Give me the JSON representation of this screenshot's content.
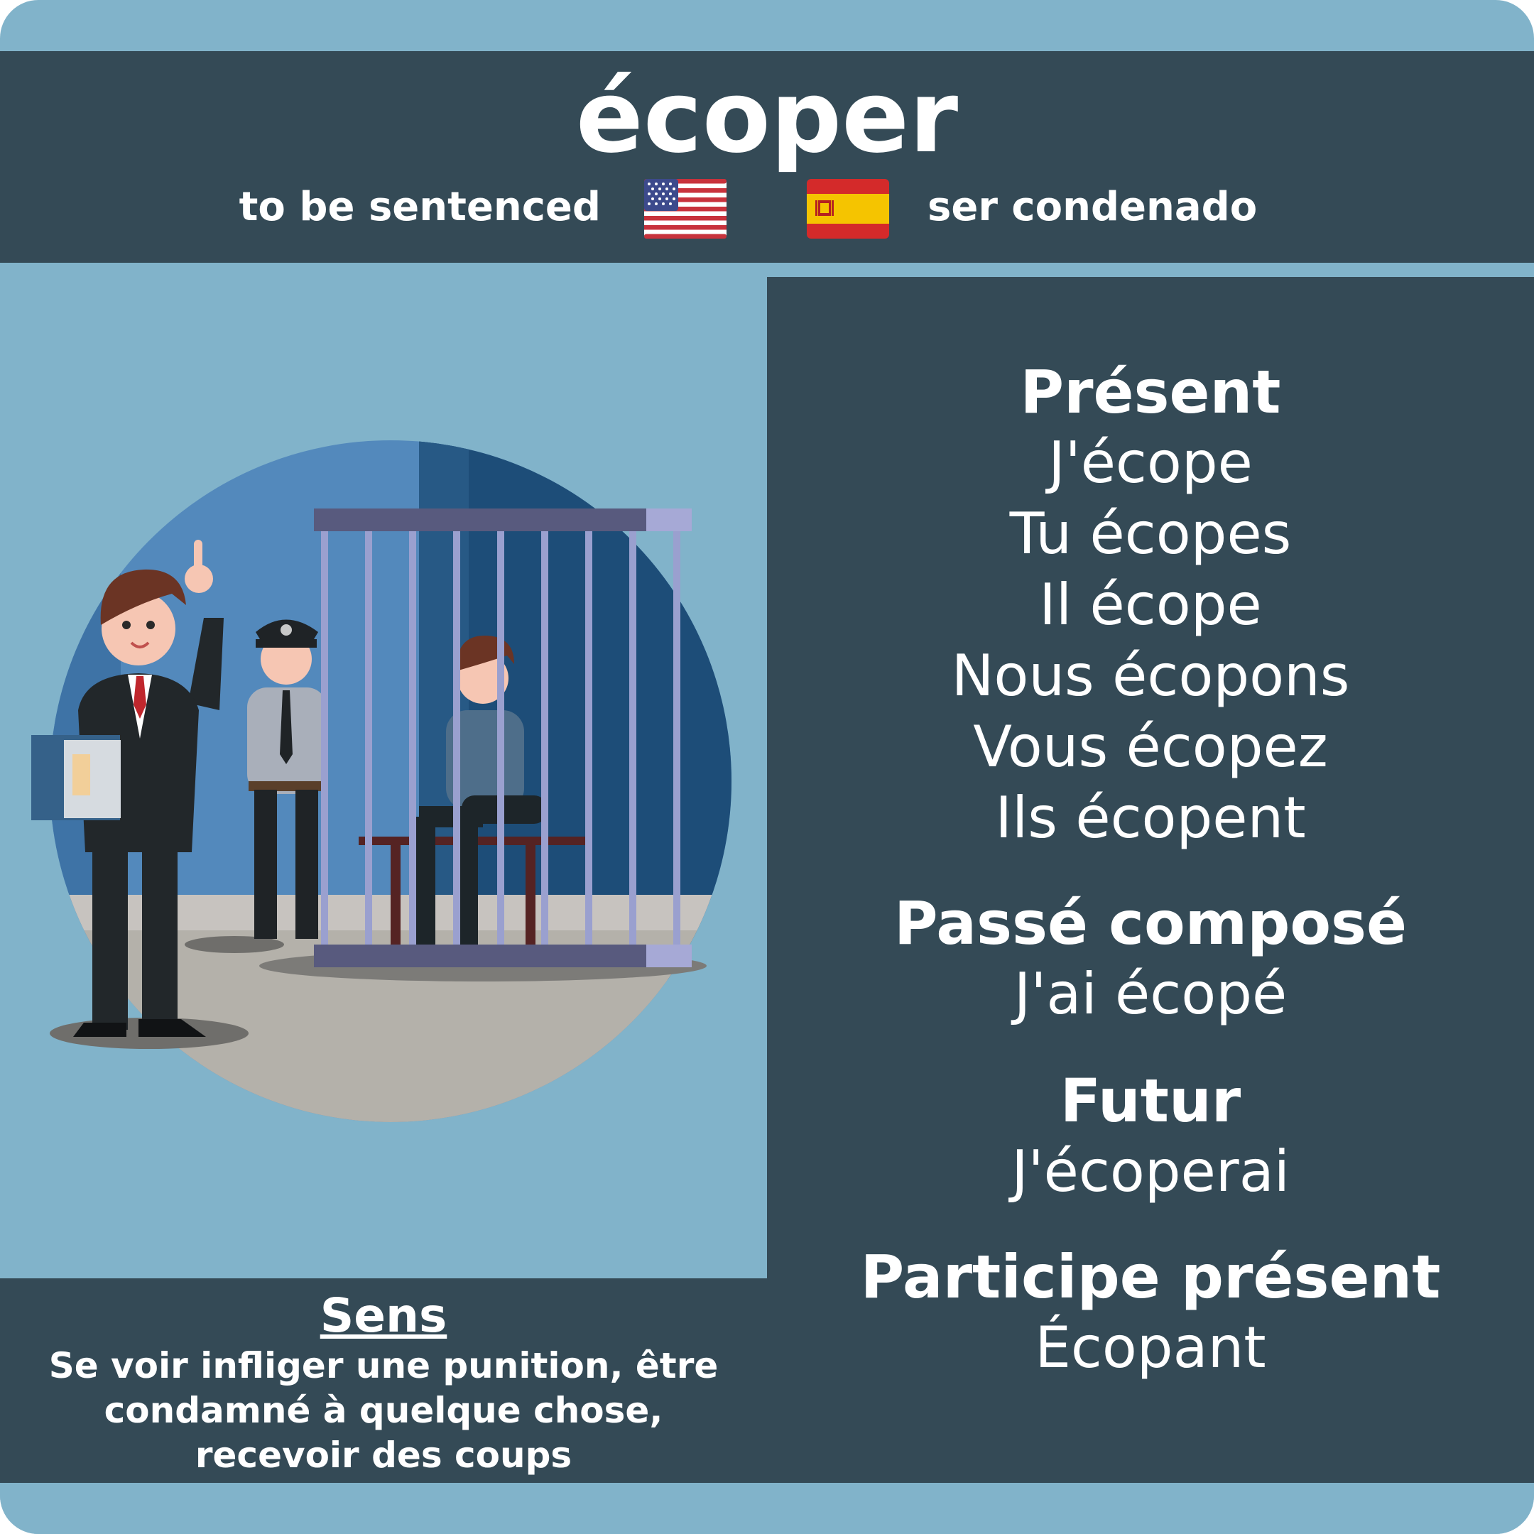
{
  "header": {
    "word": "écoper",
    "english": "to be sentenced",
    "spanish": "ser condenado"
  },
  "conjugation": {
    "present": {
      "label": "Présent",
      "forms": [
        "J'écope",
        "Tu écopes",
        "Il écope",
        "Nous écopons",
        "Vous écopez",
        "Ils écopent"
      ]
    },
    "passe_compose": {
      "label": "Passé composé",
      "form": "J'ai écopé"
    },
    "futur": {
      "label": "Futur",
      "form": "J'écoperai"
    },
    "participe_present": {
      "label": "Participe présent",
      "form": "Écopant"
    }
  },
  "meaning": {
    "title": "Sens",
    "lines": [
      "Se voir infliger une punition, être",
      "condamné à quelque chose,",
      "recevoir des coups"
    ]
  },
  "icons": {
    "us_flag": "us-flag-icon",
    "es_flag": "spain-flag-icon",
    "illustration": "courtroom-prison-illustration"
  },
  "colors": {
    "background": "#81b3ca",
    "panel": "#344a56",
    "text": "#ffffff"
  }
}
